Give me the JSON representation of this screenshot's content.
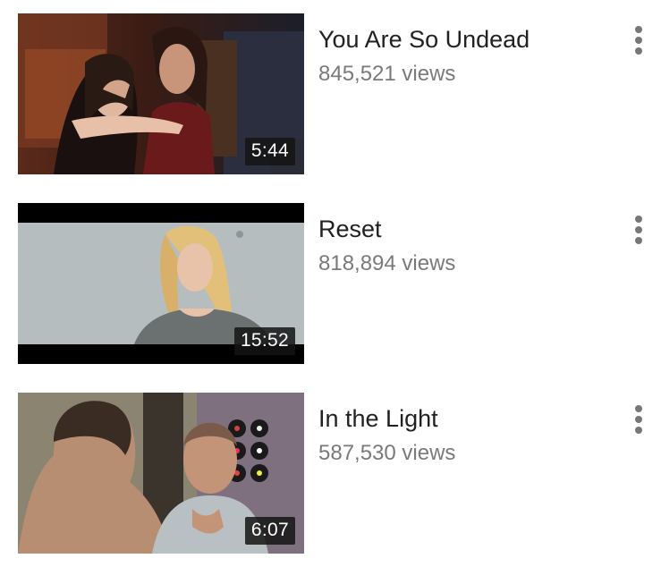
{
  "videos": [
    {
      "title": "You Are So Undead",
      "views": "845,521 views",
      "duration": "5:44",
      "thumbnail": "two-women-embrace-scene"
    },
    {
      "title": "Reset",
      "views": "818,894 views",
      "duration": "15:52",
      "thumbnail": "blonde-woman-letterbox-scene"
    },
    {
      "title": "In the Light",
      "views": "587,530 views",
      "duration": "6:07",
      "thumbnail": "two-men-room-scene"
    }
  ],
  "icons": {
    "menu": "more-vert-icon"
  },
  "colors": {
    "title": "#212121",
    "views": "#7a7a7a",
    "badge": "#141414",
    "menu": "#777777"
  }
}
